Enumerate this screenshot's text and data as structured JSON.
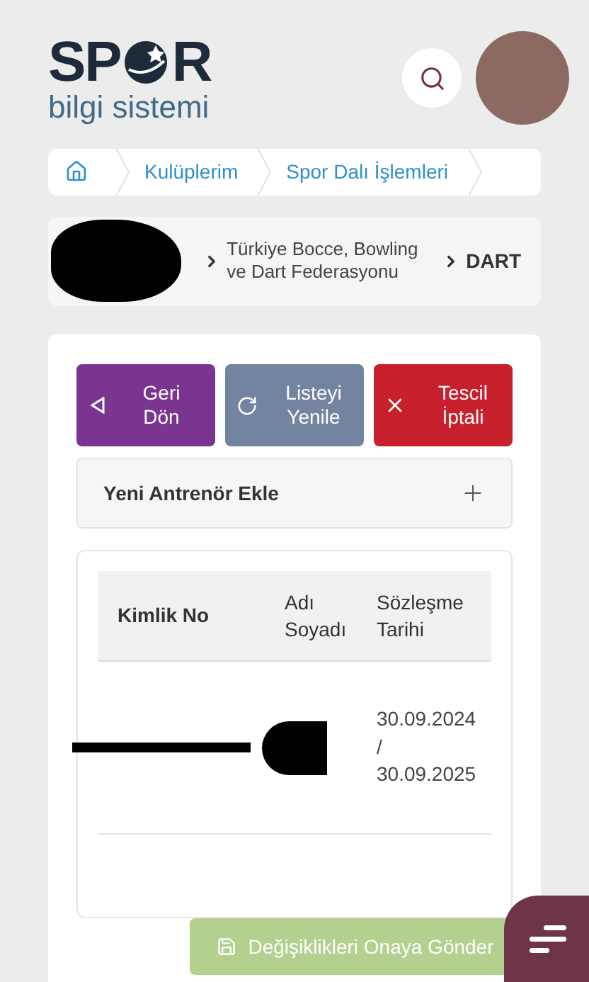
{
  "header": {
    "logo_left": "SP",
    "logo_right": "R",
    "logo_subtitle": "bilgi sistemi"
  },
  "breadcrumb": [
    {
      "label": "Kulüplerim"
    },
    {
      "label": "Spor Dalı İşlemleri"
    }
  ],
  "context": {
    "club_redacted": true,
    "items": [
      "Türkiye Bocce, Bowling ve Dart Federasyonu",
      "DART"
    ]
  },
  "actions": [
    {
      "kind": "back",
      "label": "Geri Dön"
    },
    {
      "kind": "refresh",
      "label": "Listeyi Yenile"
    },
    {
      "kind": "cancel",
      "label": "Tescil İptali"
    }
  ],
  "accordion": {
    "label": "Yeni Antrenör Ekle",
    "expanded": false
  },
  "table": {
    "columns": [
      "Kimlik No",
      "Adı Soyadı",
      "Sözleşme Tarihi"
    ],
    "rows": [
      {
        "id_redacted": true,
        "name_redacted": true,
        "contract_date": [
          "30.09.2024",
          "/",
          "30.09.2025"
        ]
      }
    ]
  },
  "submit": {
    "label": "Değişiklikleri Onaya Gönder",
    "disabled": true
  }
}
